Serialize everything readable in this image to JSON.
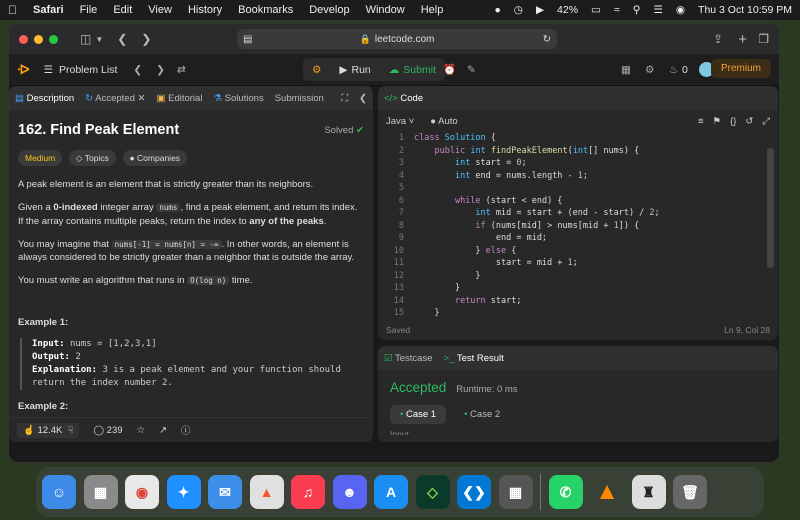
{
  "menubar": {
    "app": "Safari",
    "items": [
      "File",
      "Edit",
      "View",
      "History",
      "Bookmarks",
      "Develop",
      "Window",
      "Help"
    ],
    "battery": "42%",
    "datetime": "Thu 3 Oct  10:59 PM"
  },
  "browser": {
    "url": "leetcode.com"
  },
  "toolbar": {
    "problem_list": "Problem List",
    "run": "Run",
    "submit": "Submit",
    "streak": "0",
    "premium": "Premium"
  },
  "left_tabs": [
    "Description",
    "Accepted",
    "Editorial",
    "Solutions",
    "Submission"
  ],
  "problem": {
    "title": "162. Find Peak Element",
    "status": "Solved",
    "difficulty": "Medium",
    "topics": "Topics",
    "companies": "Companies",
    "p1": "A peak element is an element that is strictly greater than its neighbors.",
    "p2a": "Given a ",
    "p2b": "0-indexed",
    "p2c": " integer array ",
    "p2d": "nums",
    "p2e": ", find a peak element, and return its index. If the array contains multiple peaks, return the index to ",
    "p2f": "any of the peaks",
    "p2g": ".",
    "p3a": "You may imagine that ",
    "p3b": "nums[-1] = nums[n] = -∞",
    "p3c": ". In other words, an element is always considered to be strictly greater than a neighbor that is outside the array.",
    "p4a": "You must write an algorithm that runs in ",
    "p4b": "O(log n)",
    "p4c": " time.",
    "example1_title": "Example 1:",
    "example1_input_label": "Input:",
    "example1_input": "nums = [1,2,3,1]",
    "example1_output_label": "Output:",
    "example1_output": "2",
    "example1_expl_label": "Explanation:",
    "example1_expl": "3 is a peak element and your function should\nreturn the index number 2.",
    "example2_title": "Example 2:"
  },
  "desc_footer": {
    "likes": "12.4K",
    "comments": "239"
  },
  "editor": {
    "tab": "Code",
    "language": "Java",
    "mode": "Auto",
    "saved": "Saved",
    "position": "Ln 9, Col 28"
  },
  "result": {
    "tab1": "Testcase",
    "tab2": "Test Result",
    "status": "Accepted",
    "runtime": "Runtime: 0 ms",
    "case1": "Case 1",
    "case2": "Case 2",
    "input_label": "Input"
  },
  "colors": {
    "accepted": "#2cbb5d",
    "medium": "#ffc01e",
    "premium": "#f0a43a"
  }
}
